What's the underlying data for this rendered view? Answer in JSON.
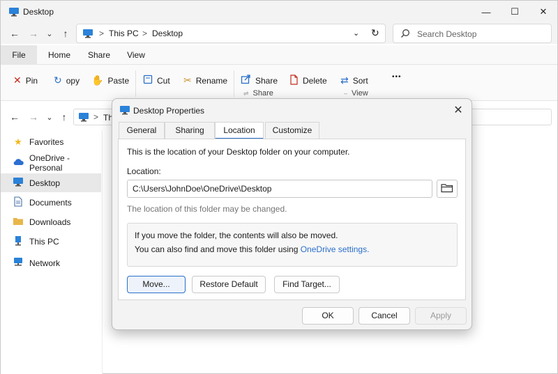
{
  "window": {
    "title": "Desktop",
    "controls": {
      "minimize": "—",
      "maximize": "☐",
      "close": "✕"
    }
  },
  "navbar": {
    "back": "←",
    "forward": "→",
    "recent": "⌄",
    "up": "↑",
    "breadcrumb": [
      "This PC",
      "Desktop"
    ],
    "separator": ">",
    "dropdown": "⌄",
    "refresh": "↻",
    "search_placeholder": "Search Desktop"
  },
  "ribbon_tabs": [
    "File",
    "Home",
    "Share",
    "View"
  ],
  "ribbon": {
    "pin": "Pin",
    "copy": "opy",
    "paste": "Paste",
    "cut": "Cut",
    "rename": "Rename",
    "share": "Share",
    "share_sub": "Share",
    "delete": "Delete",
    "sort": "Sort",
    "view_sub": "View",
    "more": "•••"
  },
  "nav2": {
    "partial": "Th"
  },
  "sidebar": {
    "items": [
      {
        "label": "Favorites",
        "icon": "star-icon"
      },
      {
        "label": "OneDrive - Personal",
        "icon": "cloud-icon"
      },
      {
        "label": "Desktop",
        "icon": "monitor-icon"
      },
      {
        "label": "Documents",
        "icon": "document-icon"
      },
      {
        "label": "Downloads",
        "icon": "folder-icon"
      },
      {
        "label": "This PC",
        "icon": "computer-icon"
      },
      {
        "label": "Network",
        "icon": "network-icon"
      }
    ]
  },
  "dialog": {
    "title": "Desktop Properties",
    "tabs": [
      "General",
      "Sharing",
      "Location",
      "Customize"
    ],
    "active_tab": "Location",
    "description": "This is the location of your Desktop folder on your computer.",
    "location_label": "Location:",
    "location_value": "C:\\Users\\JohnDoe\\OneDrive\\Desktop",
    "hint": "The location of this folder may be changed.",
    "info_line1": "If you move the folder, the contents will also be moved.",
    "info_line2_prefix": "You can also find and move this folder using ",
    "info_link": "OneDrive settings.",
    "buttons": {
      "move": "Move...",
      "restore": "Restore Default",
      "find": "Find Target..."
    },
    "footer": {
      "ok": "OK",
      "cancel": "Cancel",
      "apply": "Apply"
    }
  },
  "colors": {
    "accent": "#2a6fc9",
    "monitor_blue": "#2b82d9",
    "star": "#f2b81b",
    "folder": "#e8b64a"
  }
}
